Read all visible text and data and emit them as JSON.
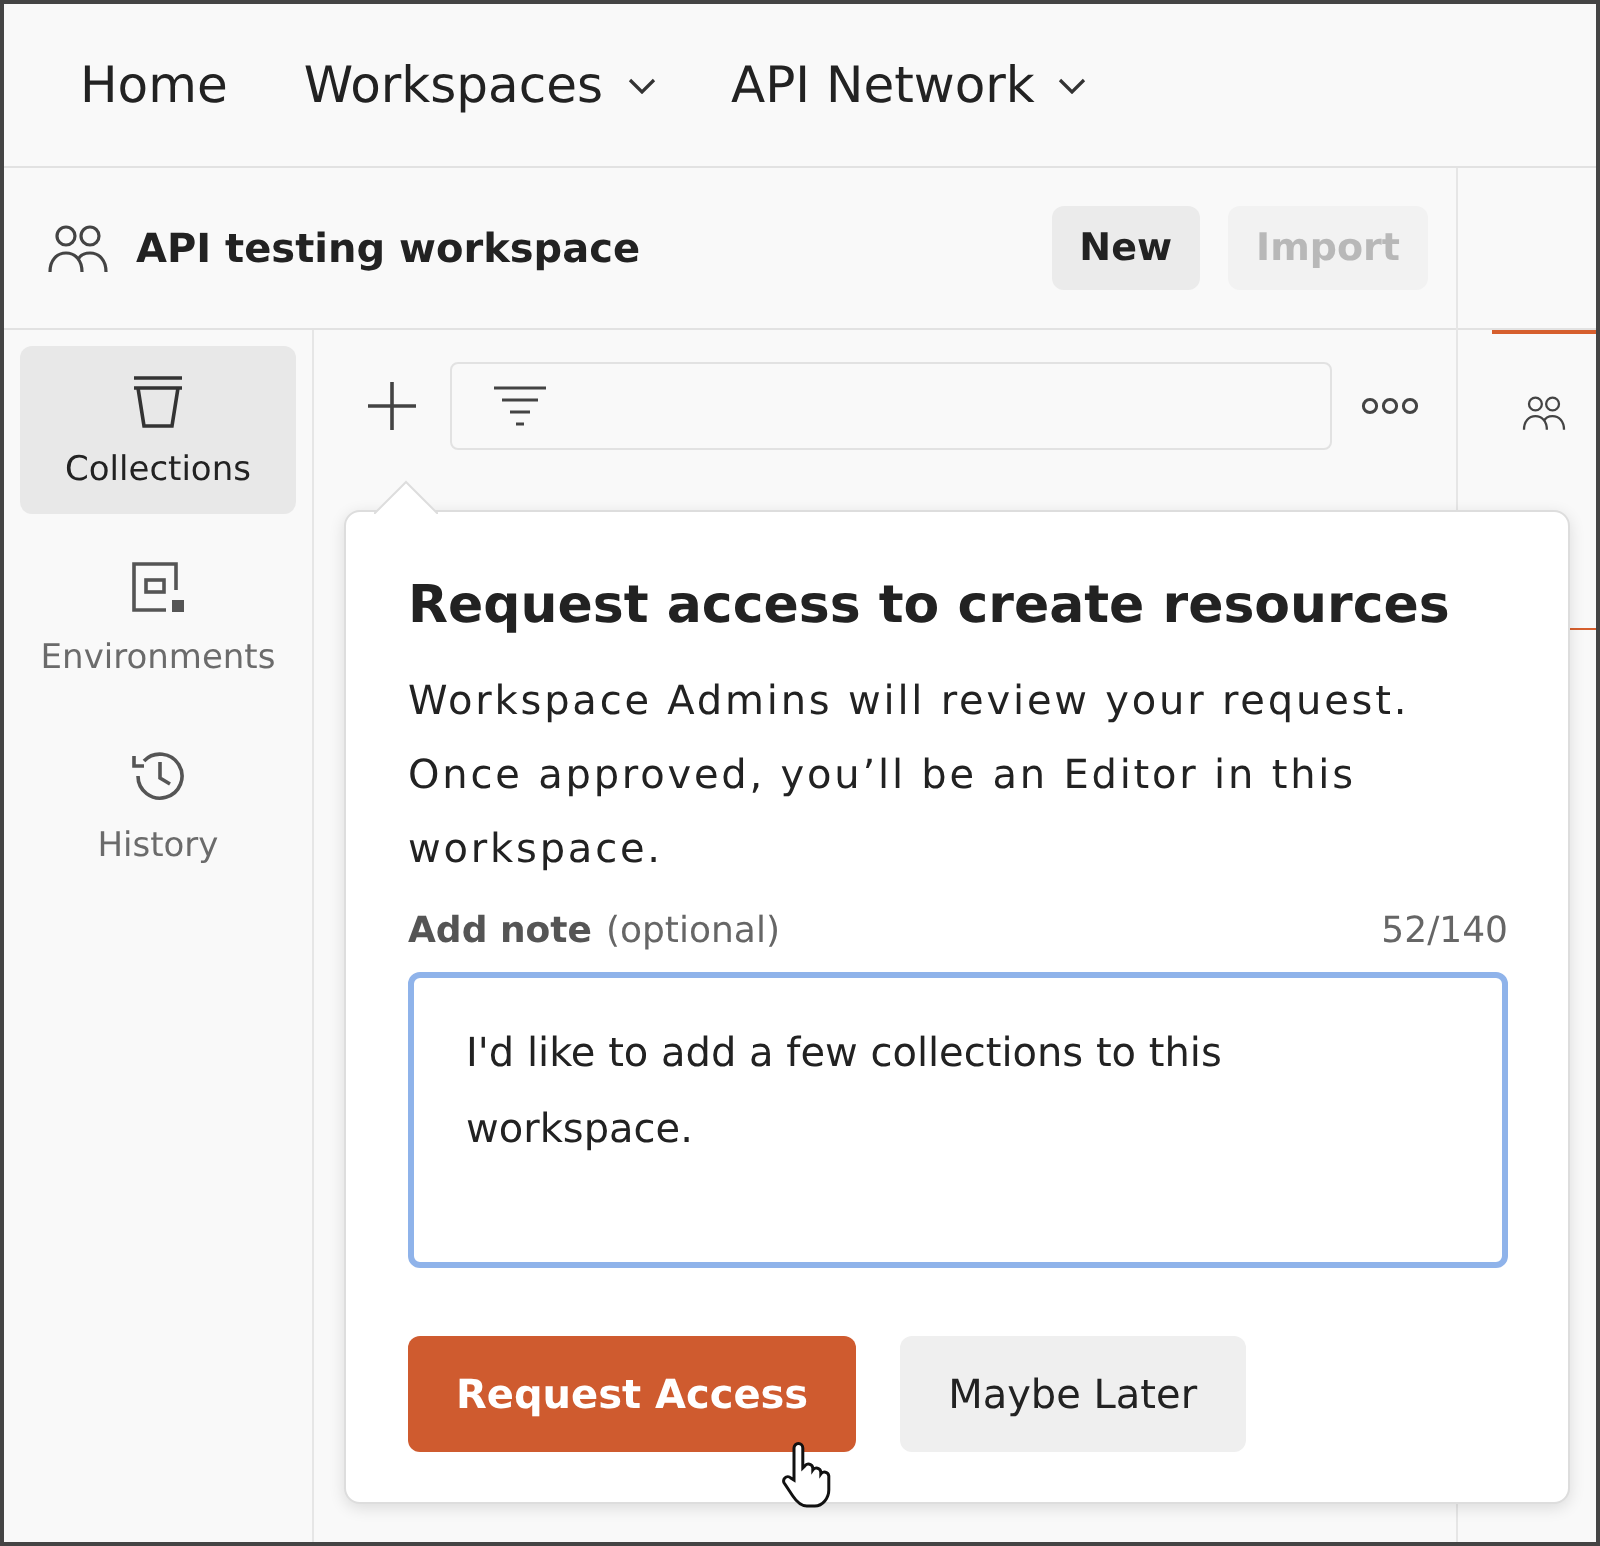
{
  "top_nav": [
    {
      "label": "Home",
      "has_menu": false
    },
    {
      "label": "Workspaces",
      "has_menu": true
    },
    {
      "label": "API Network",
      "has_menu": true
    }
  ],
  "workspace": {
    "title": "API testing workspace",
    "buttons": [
      {
        "label": "New",
        "disabled": false
      },
      {
        "label": "Import",
        "disabled": true
      }
    ]
  },
  "sidebar": {
    "items": [
      {
        "label": "Collections",
        "kind": "collections",
        "selected": true
      },
      {
        "label": "Environments",
        "kind": "environments",
        "selected": false
      },
      {
        "label": "History",
        "kind": "history",
        "selected": false
      }
    ]
  },
  "popover": {
    "title": "Request access to create resources",
    "message": "Workspace Admins will review your request. Once approved, you’ll be an Editor in this workspace.",
    "note_label": "Add note",
    "note_hint": "(optional)",
    "counter": "52/140",
    "note_value": "I'd like to add a few collections to this workspace.",
    "buttons": [
      {
        "label": "Request Access",
        "kind": "primary"
      },
      {
        "label": "Maybe Later",
        "kind": "secondary"
      }
    ]
  }
}
